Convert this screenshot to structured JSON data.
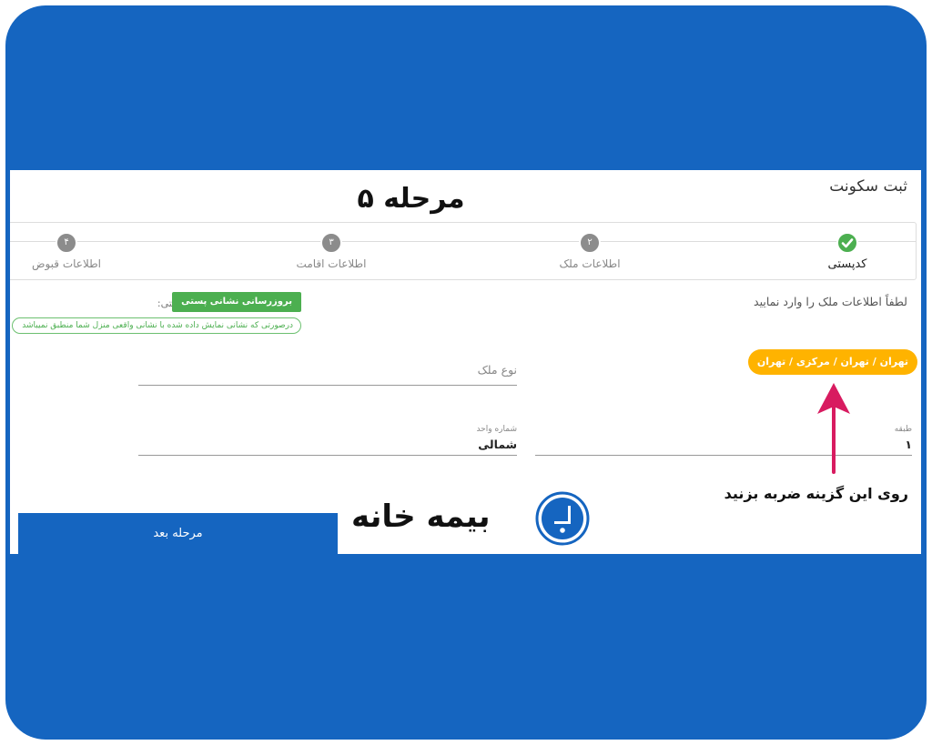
{
  "page": {
    "title": "ثبت سکونت",
    "overlay_title": "مرحله ۵"
  },
  "stepper": {
    "steps": [
      {
        "label": "کدپستی",
        "state": "done",
        "number": ""
      },
      {
        "label": "اطلاعات ملک",
        "state": "pending",
        "number": "۲"
      },
      {
        "label": "اطلاعات اقامت",
        "state": "pending",
        "number": "۳"
      },
      {
        "label": "اطلاعات قبوض",
        "state": "pending",
        "number": "۴"
      }
    ]
  },
  "form": {
    "instruction": "لطفاً اطلاعات ملک را وارد نمایید",
    "postal_code_label": "کدپستی:",
    "update_button": "بروزرسانی نشانی پستی",
    "notice": "درصورتی که نشانی نمایش داده شده با نشانی واقعی منزل شما منطبق نمیباشد",
    "address": "تهران / تهران / مرکزی / تهران",
    "property_type_placeholder": "نوع ملک",
    "floor_label": "طبقه",
    "floor_value": "۱",
    "unit_label": "شماره واحد",
    "unit_value": "شمالی",
    "next_button": "مرحله بعد"
  },
  "annotation": {
    "text": "روی این گزینه ضربه بزنید",
    "arrow_color": "#d81b60"
  },
  "brand": {
    "name": "بیمه خانه",
    "mark_letter": "ب",
    "color": "#1565c0"
  },
  "colors": {
    "frame": "#1565c0",
    "success": "#4caf50",
    "address_pill": "#ffb300",
    "next_button": "#1565c0"
  }
}
